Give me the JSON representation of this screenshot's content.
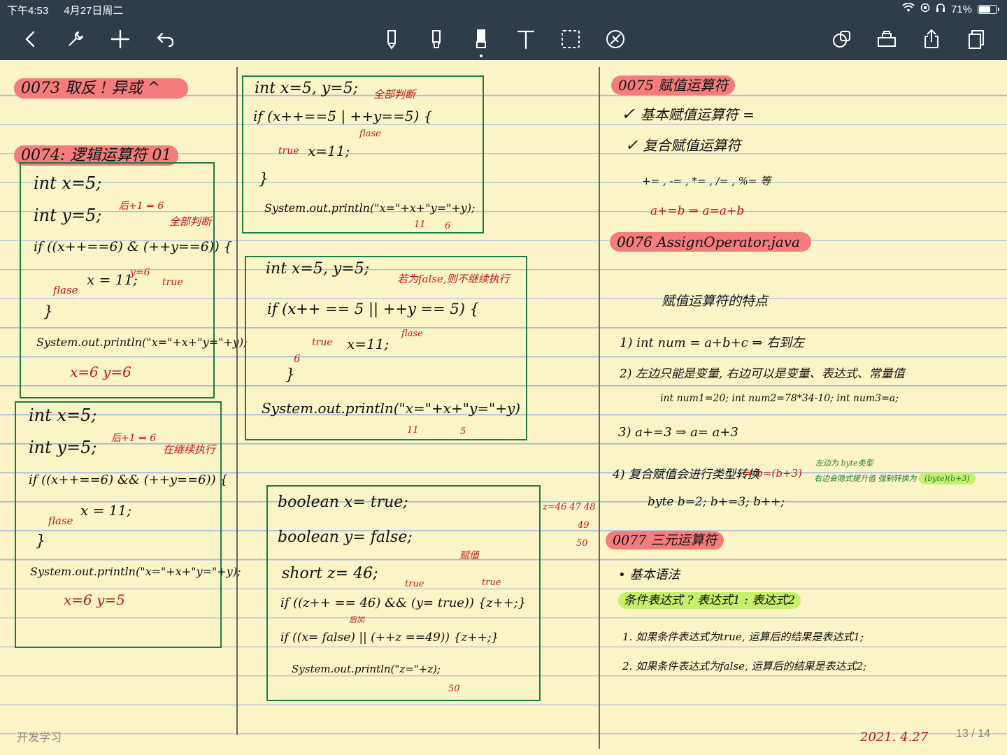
{
  "status": {
    "time": "下午4:53",
    "date": "4月27日周二",
    "battery": "71%",
    "battery_level": 0.71
  },
  "toolbar": {
    "left": [
      "back-icon",
      "wrench-icon",
      "plus-icon",
      "undo-icon"
    ],
    "tools": [
      "pen-icon",
      "highlighter-icon",
      "eraser-icon",
      "text-icon",
      "lasso-icon",
      "shape-icon"
    ],
    "selected_tool": "eraser-icon",
    "right": [
      "shapes-icon",
      "layout-icon",
      "share-icon",
      "pages-icon"
    ]
  },
  "notebook": {
    "name": "开发学习",
    "page_current": "13",
    "page_total": "14",
    "page_indicator": "13 / 14",
    "date_note": "2021. 4.27"
  },
  "left": {
    "h0073": "0073  取反 !  异或 ^",
    "h0074": "0074: 逻辑运算符 01",
    "box1": {
      "l1": "int x=5;",
      "l2": "int y=5;",
      "note_after": "后+1 ⇒ 6",
      "note_all": "全部判断",
      "l3": "if ((x++==6) & (++y==6)) {",
      "y6": "y=6",
      "flase": "flase",
      "true": "true",
      "l4": "x = 11;",
      "l5": "}",
      "l6": "System.out.println(\"x=\"+x+\"y=\"+y);",
      "result": "x=6  y=6"
    },
    "box2": {
      "l1": "int x=5;",
      "l2": "int y=5;",
      "note_after": "后+1 ⇒ 6",
      "note_cont": "在继续执行",
      "l3": "if ((x++==6) && (++y==6)) {",
      "flase": "flase",
      "l4": "x = 11;",
      "l5": "}",
      "l6": "System.out.println(\"x=\"+x+\"y=\"+y);",
      "result": "x=6  y=5"
    }
  },
  "middle": {
    "box3": {
      "l1": "int x=5, y=5;",
      "note_all": "全部判断",
      "l2": "if (x++==5 | ++y==5) {",
      "flase": "flase",
      "true": "true",
      "l3": "x=11;",
      "l4": "}",
      "l5": "System.out.println(\"x=\"+x+\"y=\"+y);",
      "r1": "11",
      "r2": "6"
    },
    "box4": {
      "l1": "int x=5, y=5;",
      "note_skip": "若为false,则不继续执行",
      "l2": "if (x++ == 5 || ++y == 5) {",
      "n6": "6",
      "true": "true",
      "l3": "x=11;",
      "flase": "flase",
      "l4": "}",
      "l5": "System.out.println(\"x=\"+x+\"y=\"+y)",
      "r1": "11",
      "r2": "5"
    },
    "box5": {
      "l1": "boolean   x= true;",
      "l2": "boolean   y= false;",
      "l3": "short     z= 46;",
      "l4": "if ((z++ == 46) && (y= true)) {z++;}",
      "l5": "if ((x= false) || (++z ==49)) {z++;}",
      "l6": "System.out.println(\"z=\"+z);",
      "n_assign": "赋值",
      "n_true1": "true",
      "n_true2": "true",
      "n_after": "后加",
      "n_result": "50",
      "side1": "z=46 47 48",
      "side2": "49",
      "side3": "50"
    }
  },
  "right": {
    "h0075": "0075  赋值运算符",
    "basic": "基本赋值运算符  =",
    "compound": "复合赋值运算符",
    "ops": "+= , -= , *= , /= , %= 等",
    "example": "a+=b  ⇒ a=a+b",
    "h0076": "0076   AssignOperator.java",
    "features": "赋值运算符的特点",
    "p1": "1)   int num = a+b+c   ⇒ 右到左",
    "p2": "2)   左边只能是变量, 右边可以是变量、表达式、常量值",
    "p2code": "int num1=20;  int num2=78*34-10;  int num3=a;",
    "p3": "3)   a+=3  ⇒  a= a+3",
    "p4": "4)   复合赋值会进行类型转换",
    "p4code": "byte b=2;  b+=3;  b++;",
    "p4cast": "⇒ b=(b+3)",
    "p4note1": "左边为 byte类型",
    "p4note2": "右边会隐式提升值 强制转换为",
    "p4hl": "(byte)(b+3)",
    "h0077": "0077  三元运算符",
    "syntax": "• 基本语法",
    "formula": "条件表达式 ? 表达式1 : 表达式2",
    "r1": "1. 如果条件表达式为true, 运算后的结果是表达式1;",
    "r2": "2. 如果条件表达式为false, 运算后的结果是表达式2;"
  }
}
